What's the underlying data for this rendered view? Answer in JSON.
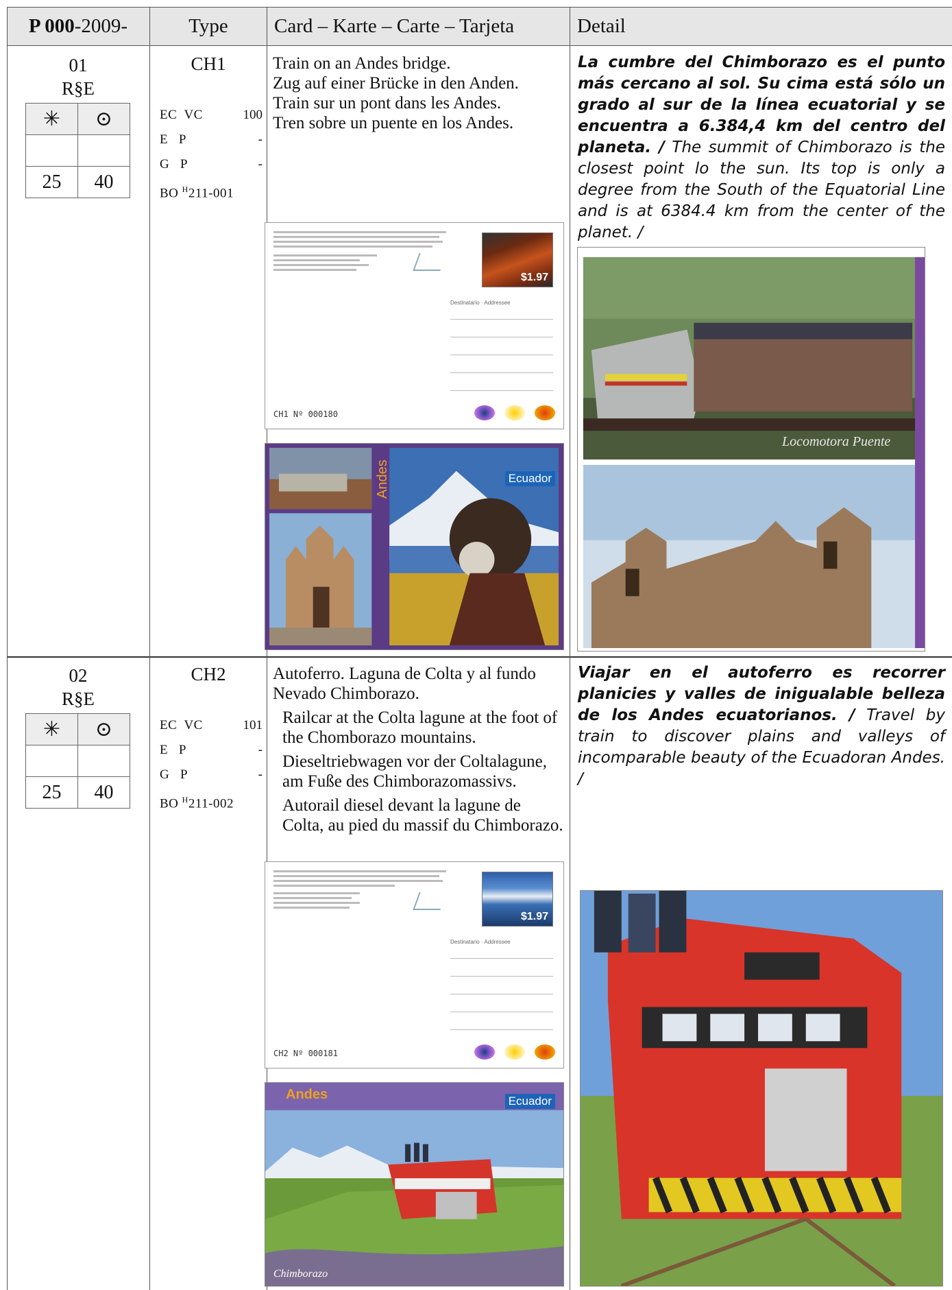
{
  "header": {
    "catalog_prefix": "P 000",
    "catalog_suffix": "-2009-",
    "type_label": "Type",
    "card_label": "Card – Karte – Carte – Tarjeta",
    "detail_label": "Detail"
  },
  "quantity_symbols": {
    "mint": "✳",
    "used": "⊙"
  },
  "entries": [
    {
      "number": "01",
      "rse": "R§E",
      "mint_price": "25",
      "used_price": "40",
      "type": "CH1",
      "codes": {
        "ec": "EC",
        "vc": "VC",
        "vc_num": "100",
        "e": "E",
        "e_p": "P",
        "e_val": "-",
        "g": "G",
        "g_p": "P",
        "g_val": "-",
        "bo": "BO",
        "bo_sup": "H",
        "bo_num": "211-001"
      },
      "card_text": [
        "Train on an Andes bridge.",
        "Zug auf einer Brücke in den Anden.",
        "Train sur un pont dans les Andes.",
        "Tren sobre un puente en los Andes."
      ],
      "detail_es": "La cumbre del Chimborazo es el punto más cercano al sol. Su cima está sólo un grado al sur de la línea ecuatorial y se encuentra a 6.384,4 km del centro del planeta. /",
      "detail_en": "The summit of Chimborazo is the closest point lo the sun. Its top is only a degree from the South of the Equatorial Line and is at 6384.4 km from the center of the planet. /",
      "card_serial": "CH1  Nº  000180",
      "stamp_value": "$1.97",
      "photo_caption": "Locomotora Puente",
      "front_brand": "Andes",
      "front_country": "Ecuador"
    },
    {
      "number": "02",
      "rse": "R§E",
      "mint_price": "25",
      "used_price": "40",
      "type": "CH2",
      "codes": {
        "ec": "EC",
        "vc": "VC",
        "vc_num": "101",
        "e": "E",
        "e_p": "P",
        "e_val": "-",
        "g": "G",
        "g_p": "P",
        "g_val": "-",
        "bo": "BO",
        "bo_sup": "H",
        "bo_num": "211-002"
      },
      "card_text": [
        "Autoferro. Laguna de Colta y al fundo Nevado Chimborazo.",
        "Railcar at the Colta lagune at the foot of the Chomborazo mountains.",
        "Dieseltriebwagen vor der Coltalagune, am Fuße des Chimborazomassivs.",
        "Autorail diesel devant la lagune de Colta, au pied du massif du Chimborazo."
      ],
      "detail_es": "Viajar en el autoferro es recorrer planicies y valles de inigualable belleza de los Andes ecuatorianos. /",
      "detail_en": "Travel by train to discover plains and valleys of incomparable beauty of the Ecuadoran Andes. /",
      "card_serial": "CH2  Nº  000181",
      "stamp_value": "$1.97",
      "front_brand": "Andes",
      "front_country": "Ecuador",
      "front_place": "Chimborazo"
    }
  ]
}
